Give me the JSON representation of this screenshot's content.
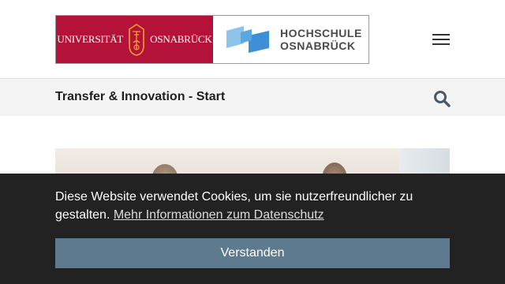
{
  "header": {
    "logo_uni": {
      "part1": "UNIVERSITÄT",
      "part2": "OSNABRÜCK"
    },
    "logo_hs": {
      "line1": "HOCHSCHULE",
      "line2": "OSNABRÜCK"
    },
    "menu_icon": "hamburger-icon"
  },
  "navbar": {
    "title": "Transfer & Innovation - Start",
    "search_icon": "search-icon"
  },
  "cookie": {
    "message": "Diese Website verwendet Cookies, um sie nutzerfreundlicher zu gestalten.",
    "link_label": "Mehr Informationen zum Datenschutz",
    "button_label": "Verstanden"
  },
  "colors": {
    "uni_red": "#b5123a",
    "hs_blue": "#3e8fd6",
    "banner_bg": "#222222",
    "button_bg": "#5e7a8e"
  }
}
